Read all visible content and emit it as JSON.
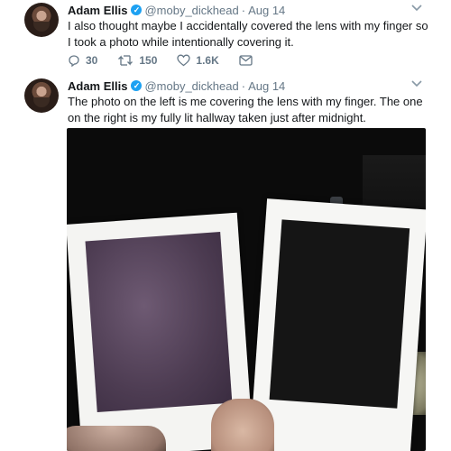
{
  "tweets": [
    {
      "author_name": "Adam Ellis",
      "verified_mark": "✓",
      "handle": "@moby_dickhead",
      "separator": "·",
      "date": "Aug 14",
      "text": "I also thought maybe I accidentally covered the lens with my finger so I took a photo while intentionally covering it.",
      "actions": {
        "reply_count": "30",
        "retweet_count": "150",
        "like_count": "1.6K"
      }
    },
    {
      "author_name": "Adam Ellis",
      "verified_mark": "✓",
      "handle": "@moby_dickhead",
      "separator": "·",
      "date": "Aug 14",
      "text": "The photo on the left is me covering the lens with my finger. The one on the right is my fully lit hallway taken just after midnight."
    }
  ],
  "icons": {
    "chevron": "chevron-down-icon",
    "reply": "reply-icon",
    "retweet": "retweet-icon",
    "like": "heart-icon",
    "message": "mail-icon"
  },
  "colors": {
    "verified": "#1da1f2",
    "secondary_text": "#657786",
    "primary_text": "#14171a"
  }
}
